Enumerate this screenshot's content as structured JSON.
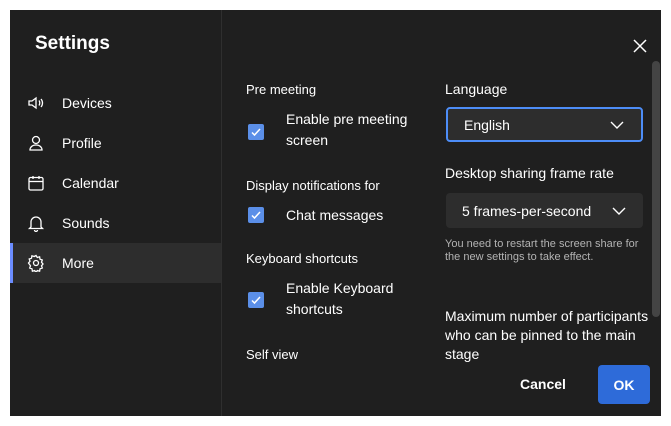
{
  "sidebar": {
    "title": "Settings",
    "items": [
      {
        "label": "Devices",
        "icon": "speaker-icon"
      },
      {
        "label": "Profile",
        "icon": "person-icon"
      },
      {
        "label": "Calendar",
        "icon": "calendar-icon"
      },
      {
        "label": "Sounds",
        "icon": "bell-icon"
      },
      {
        "label": "More",
        "icon": "gear-icon",
        "active": true
      }
    ]
  },
  "left_column": {
    "pre_meeting_heading": "Pre meeting",
    "enable_pre_meeting_screen": {
      "label_line1": "Enable pre meeting",
      "label_line2": "screen",
      "checked": true
    },
    "notifications_heading": "Display notifications for",
    "chat_messages": {
      "label": "Chat messages",
      "checked": true
    },
    "keyboard_heading": "Keyboard shortcuts",
    "enable_keyboard_shortcuts": {
      "label_line1": "Enable Keyboard",
      "label_line2": "shortcuts",
      "checked": true
    },
    "self_view_heading": "Self view"
  },
  "right_column": {
    "language_label": "Language",
    "language_value": "English",
    "frame_rate_label": "Desktop sharing frame rate",
    "frame_rate_value": "5 frames-per-second",
    "restart_hint": "You need to restart the screen share for the new settings to take effect.",
    "max_pinned_label": "Maximum number of participants who can be pinned to the main stage"
  },
  "footer": {
    "cancel_label": "Cancel",
    "ok_label": "OK"
  },
  "colors": {
    "background": "#1f1f1f",
    "accent": "#2e6bd9",
    "checkbox": "#5b8fe8",
    "focus_border": "#4d8df7"
  }
}
